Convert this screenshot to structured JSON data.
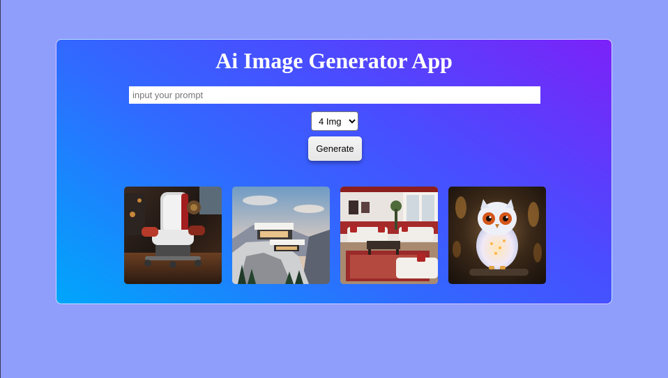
{
  "app": {
    "title": "Ai Image Generator App"
  },
  "prompt": {
    "placeholder": "input your prompt",
    "value": ""
  },
  "image_count": {
    "selected": "4 Img",
    "options": [
      "4 Img"
    ]
  },
  "actions": {
    "generate_label": "Generate"
  },
  "gallery": {
    "images": [
      {
        "subject": "mechanical armchair"
      },
      {
        "subject": "modern house on mountain cliff"
      },
      {
        "subject": "living room interior"
      },
      {
        "subject": "glowing white owl"
      }
    ]
  },
  "colors": {
    "page_background": "#8f9dfb",
    "card_gradient_start": "#00a6fb",
    "card_gradient_end": "#7b22f8",
    "title_color": "#ffffff"
  }
}
